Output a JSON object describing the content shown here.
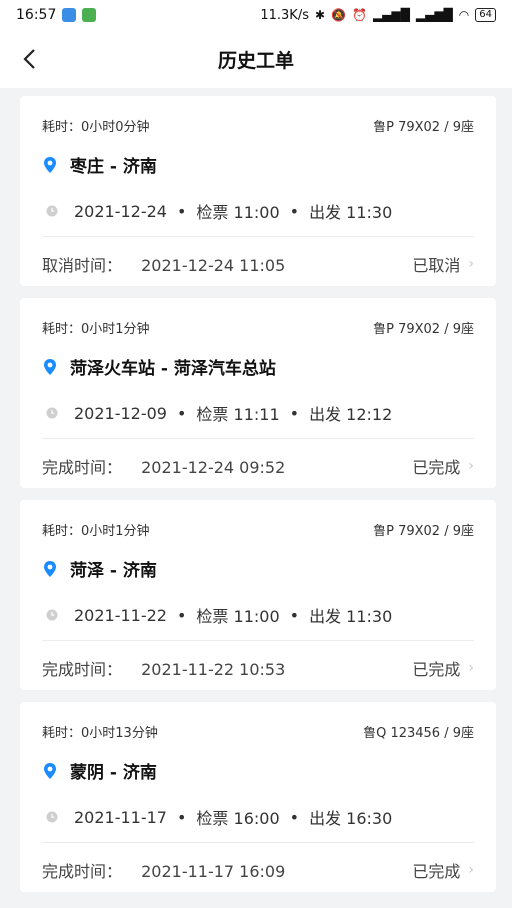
{
  "status_bar": {
    "time": "16:57",
    "net_speed": "11.3K/s",
    "battery": "64"
  },
  "header": {
    "title": "历史工单"
  },
  "orders": [
    {
      "duration": "耗时：0小时0分钟",
      "vehicle": "鲁P 79X02 / 9座",
      "route": "枣庄 - 济南",
      "date": "2021-12-24",
      "checkin": "检票 11:00",
      "depart": "出发 11:30",
      "time_label": "取消时间：",
      "time_value": "2021-12-24 11:05",
      "status": "已取消"
    },
    {
      "duration": "耗时：0小时1分钟",
      "vehicle": "鲁P 79X02 / 9座",
      "route": "菏泽火车站 - 菏泽汽车总站",
      "date": "2021-12-09",
      "checkin": "检票 11:11",
      "depart": "出发 12:12",
      "time_label": "完成时间：",
      "time_value": "2021-12-24 09:52",
      "status": "已完成"
    },
    {
      "duration": "耗时：0小时1分钟",
      "vehicle": "鲁P 79X02 / 9座",
      "route": "菏泽 - 济南",
      "date": "2021-11-22",
      "checkin": "检票 11:00",
      "depart": "出发 11:30",
      "time_label": "完成时间：",
      "time_value": "2021-11-22 10:53",
      "status": "已完成"
    },
    {
      "duration": "耗时：0小时13分钟",
      "vehicle": "鲁Q 123456 / 9座",
      "route": "蒙阴 - 济南",
      "date": "2021-11-17",
      "checkin": "检票 16:00",
      "depart": "出发 16:30",
      "time_label": "完成时间：",
      "time_value": "2021-11-17 16:09",
      "status": "已完成"
    }
  ],
  "colors": {
    "accent": "#1a8cff",
    "background": "#f2f3f5"
  }
}
